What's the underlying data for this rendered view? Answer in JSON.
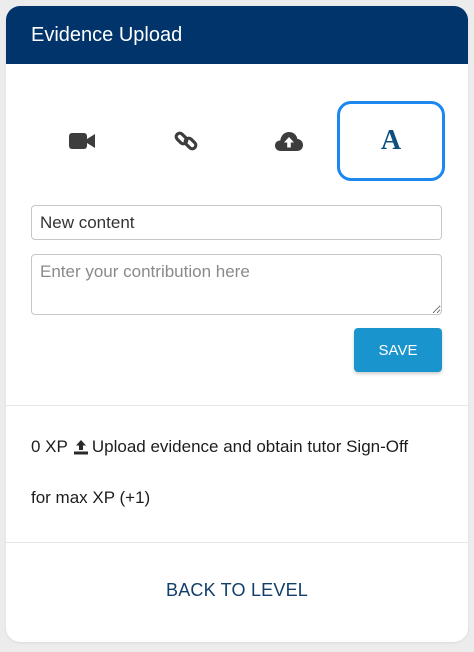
{
  "header": {
    "title": "Evidence Upload"
  },
  "tabs": [
    {
      "icon": "video-camera-icon"
    },
    {
      "icon": "link-icon"
    },
    {
      "icon": "cloud-upload-icon"
    },
    {
      "icon": "text-icon",
      "label": "A",
      "active": true
    }
  ],
  "form": {
    "title_value": "New content",
    "body_placeholder": "Enter your contribution here",
    "save_label": "SAVE"
  },
  "info": {
    "xp": "0 XP",
    "icon": "upload-icon",
    "line1_text": "Upload evidence and obtain tutor Sign-Off",
    "line2_text": "for max XP (+1)"
  },
  "footer": {
    "back_label": "BACK TO LEVEL"
  },
  "colors": {
    "header_bg": "#00346b",
    "accent_border": "#1b87ef",
    "save_button": "#1a94cc",
    "link_text": "#123e6c"
  }
}
